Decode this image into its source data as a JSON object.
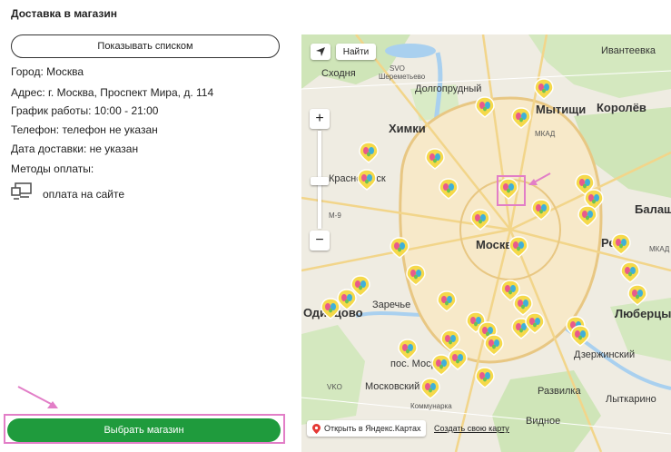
{
  "page_title": "Доставка в магазин",
  "list_button_label": "Показывать списком",
  "store": {
    "city": "Город: Москва",
    "address": "Адрес: г. Москва, Проспект Мира, д. 114",
    "schedule": "График работы: 10:00 - 21:00",
    "phone": "Телефон: телефон не указан",
    "delivery_date": "Дата доставки: не указан",
    "payment_methods_label": "Методы оплаты:",
    "payment_method": "оплата на сайте"
  },
  "select_button_label": "Выбрать магазин",
  "map": {
    "find_button_label": "Найти",
    "zoom_in": "+",
    "zoom_out": "−",
    "open_in_yandex": "Открыть в Яндекс.Картах",
    "create_map": "Создать свою карту",
    "labels": {
      "skhodnya": "Сходня",
      "svo": "SVO",
      "sheremetyevo": "Шереметьево",
      "dolgoprudny": "Долгопрудный",
      "ivanteevka": "Ивантеевка",
      "mytishchi": "Мытищи",
      "korolev": "Королёв",
      "khimki": "Химки",
      "mkad": "МКАД",
      "krasnogorsk": "Красногорск",
      "moscow": "Москва",
      "balashikha": "Балаши",
      "reutov": "Ре",
      "odintsovo": "Одинцово",
      "zarechye": "Заречье",
      "lyubertsy": "Люберцы",
      "dzerzhinsky": "Дзержинский",
      "mosrentgen": "пос. Мосрен",
      "vko": "VKO",
      "moskovsky": "Московский",
      "kommunarka": "Коммунарка",
      "razvilka": "Развилка",
      "lytkarino": "Лыткарино",
      "vidnoye": "Видное",
      "m9": "M-9"
    }
  },
  "colors": {
    "accent_green": "#1f9b3d",
    "highlight_pink": "#e27ec7",
    "pin_yellow": "#f5d94a"
  }
}
